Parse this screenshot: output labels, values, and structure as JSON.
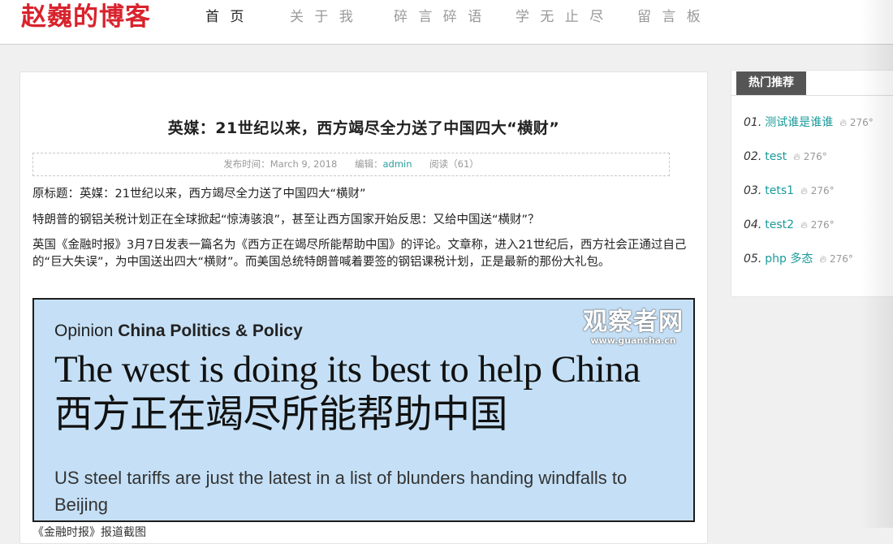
{
  "header": {
    "logo": "赵巍的博客",
    "nav": [
      {
        "label": "首 页",
        "active": true
      },
      {
        "label": "关 于 我",
        "active": false
      },
      {
        "label": "碎 言 碎 语",
        "active": false
      },
      {
        "label": "学 无 止 尽",
        "active": false
      },
      {
        "label": "留 言 板",
        "active": false
      }
    ]
  },
  "article": {
    "title": "英媒：21世纪以来，西方竭尽全力送了中国四大“横财”",
    "meta": {
      "published_label": "发布时间：",
      "published_date": "March 9, 2018",
      "editor_label": "编辑：",
      "editor": "admin",
      "reads_label": "阅读（61）"
    },
    "paragraphs": [
      "原标题：英媒：21世纪以来，西方竭尽全力送了中国四大“横财”",
      "特朗普的钢铝关税计划正在全球掀起“惊涛骇浪”，甚至让西方国家开始反思：又给中国送“横财”？",
      "英国《金融时报》3月7日发表一篇名为《西方正在竭尽所能帮助中国》的评论。文章称，进入21世纪后，西方社会正通过自己的“巨大失误”，为中国送出四大“横财”。而美国总统特朗普喊着要签的钢铝课税计划，正是最新的那份大礼包。"
    ],
    "image": {
      "opinion_prefix": "Opinion ",
      "opinion_topic": "China Politics & Policy",
      "headline": "The west is doing its best to help China 西方正在竭尽所能帮助中国",
      "subhead": "US steel tariffs are just the latest in a list of blunders handing windfalls to Beijing",
      "watermark": "观察者网",
      "watermark_url": "www.guancha.cn"
    },
    "caption": "《金融时报》报道截图"
  },
  "sidebar": {
    "title": "热门推荐",
    "items": [
      {
        "num": "01.",
        "title": "测试谁是谁谁",
        "views": "276°"
      },
      {
        "num": "02.",
        "title": "test",
        "views": "276°"
      },
      {
        "num": "03.",
        "title": "tets1",
        "views": "276°"
      },
      {
        "num": "04.",
        "title": "test2",
        "views": "276°"
      },
      {
        "num": "05.",
        "title": "php 多态",
        "views": "276°"
      }
    ]
  }
}
